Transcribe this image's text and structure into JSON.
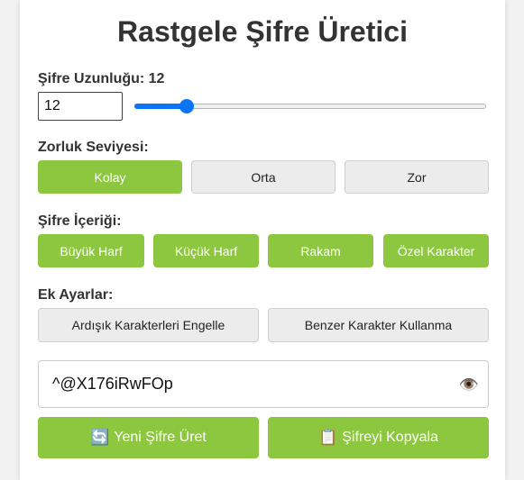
{
  "title": "Rastgele Şifre Üretici",
  "length": {
    "label": "Şifre Uzunluğu: 12",
    "value": "12",
    "min": 4,
    "max": 64,
    "current": 12
  },
  "difficulty": {
    "label": "Zorluk Seviyesi:",
    "options": [
      "Kolay",
      "Orta",
      "Zor"
    ],
    "selected": "Kolay"
  },
  "content": {
    "label": "Şifre İçeriği:",
    "options": [
      "Büyük Harf",
      "Küçük Harf",
      "Rakam",
      "Özel Karakter"
    ]
  },
  "extra": {
    "label": "Ek Ayarlar:",
    "options": [
      "Ardışık Karakterleri Engelle",
      "Benzer Karakter Kullanma"
    ]
  },
  "password": {
    "value": "^@X176iRwFOp",
    "toggle_icon": "eye-icon"
  },
  "actions": {
    "generate_icon": "🔄",
    "generate_label": "Yeni Şifre Üret",
    "copy_icon": "📋",
    "copy_label": "Şifreyi Kopyala"
  },
  "colors": {
    "accent": "#8dc63f",
    "slider": "#0b75f5",
    "inactive": "#ececec"
  }
}
